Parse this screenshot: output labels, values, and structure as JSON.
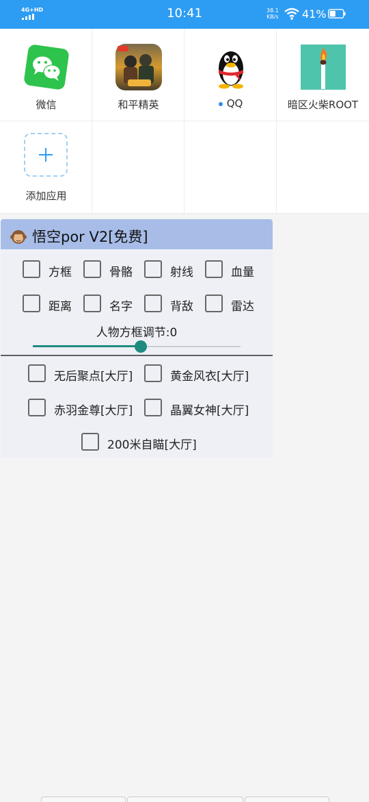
{
  "status_bar": {
    "network": "4G+HD",
    "time": "10:41",
    "speed_value": "38.1",
    "speed_unit": "KB/s",
    "battery_percent": "41%"
  },
  "apps": [
    {
      "label": "微信",
      "icon": "wechat-icon",
      "color": "#2ec34d",
      "dot": false
    },
    {
      "label": "和平精英",
      "icon": "peace-elite-icon",
      "color": "#d49a2e",
      "dot": false
    },
    {
      "label": "QQ",
      "icon": "qq-penguin-icon",
      "color": "#111111",
      "dot": true
    },
    {
      "label": "暗区火柴ROOT",
      "icon": "matchstick-icon",
      "color": "#4fc4ad",
      "dot": false
    }
  ],
  "add_app": {
    "label": "添加应用",
    "icon": "plus-icon"
  },
  "panel": {
    "title": "悟空por V2[免费]",
    "title_icon": "monkey-emoji-icon",
    "row1": [
      "方框",
      "骨骼",
      "射线",
      "血量"
    ],
    "row2": [
      "距离",
      "名字",
      "背敌",
      "雷达"
    ],
    "slider_label": "人物方框调节:0",
    "slider_fraction": 0.5,
    "row3": [
      "无后聚点[大厅]",
      "黄金风衣[大厅]"
    ],
    "row4": [
      "赤羽金尊[大厅]",
      "晶翼女神[大厅]"
    ],
    "row5": [
      "200米自瞄[大厅]"
    ]
  },
  "colors": {
    "status_bar": "#2d9cf3",
    "panel_header": "#a7bde8",
    "panel_bg": "#eef0f6",
    "slider_accent": "#1f8b80"
  }
}
